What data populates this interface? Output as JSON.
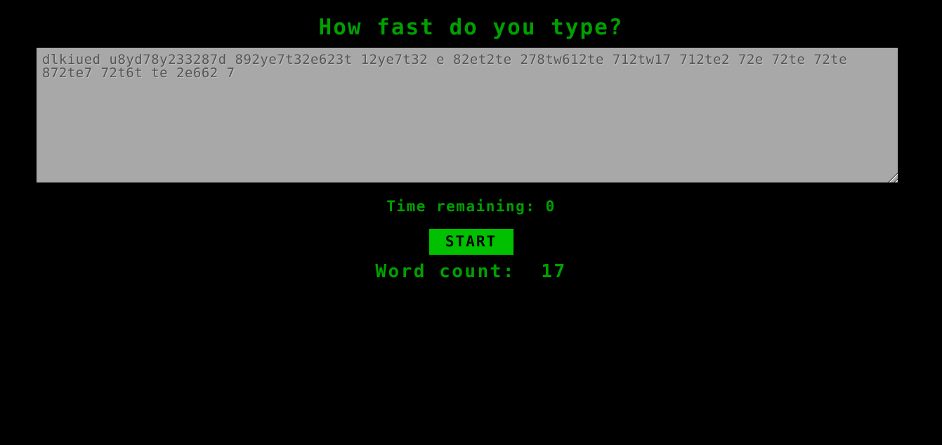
{
  "page": {
    "title": "How fast do you type?",
    "background_color": "#000000",
    "accent_color": "#00a000",
    "button_color": "#00c000",
    "textarea_background": "#a8a8a8",
    "textarea_text_color": "#555555"
  },
  "typing": {
    "value": "dlkiued u8yd78y233287d 892ye7t32e623t 12ye7t32 e 82et2te 278tw612te 712tw17 712te2 72e 72te 72te 872te7 72t6t te 2e662 7",
    "placeholder": ""
  },
  "status": {
    "time_label": "Time remaining:",
    "time_value": "0",
    "time_line": "Time remaining: 0",
    "wordcount_label": "Word count:",
    "wordcount_value": "17",
    "wordcount_line": "Word count:  17"
  },
  "controls": {
    "start_label": "START"
  },
  "icons": {
    "resize_grip": "resize-grip-icon"
  }
}
